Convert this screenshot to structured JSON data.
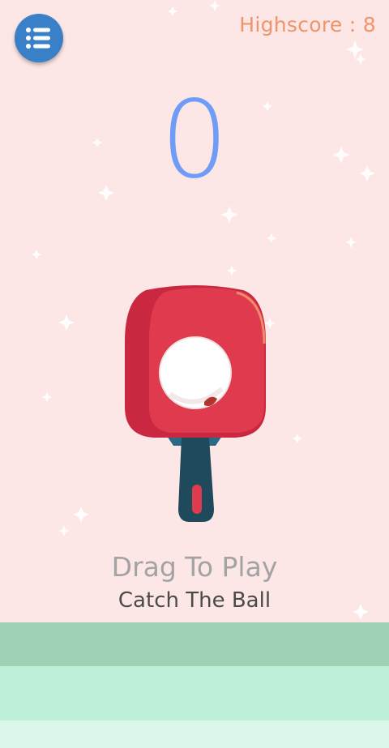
{
  "header": {
    "menu_icon": "list-icon",
    "highscore_text": "Highscore : 8"
  },
  "game": {
    "score": "0",
    "hint_primary": "Drag To Play",
    "hint_secondary": "Catch The Ball"
  },
  "colors": {
    "background": "#fde6e6",
    "menu_button": "#3a80c9",
    "highscore": "#f0946a",
    "score": "#6e9cf6",
    "paddle_rubber": "#e03a4f",
    "paddle_handle": "#1e4a5c",
    "ground_top": "#9ed2b6",
    "ground_mid": "#bdf0d9",
    "ground_bottom": "#dbf7ea"
  }
}
